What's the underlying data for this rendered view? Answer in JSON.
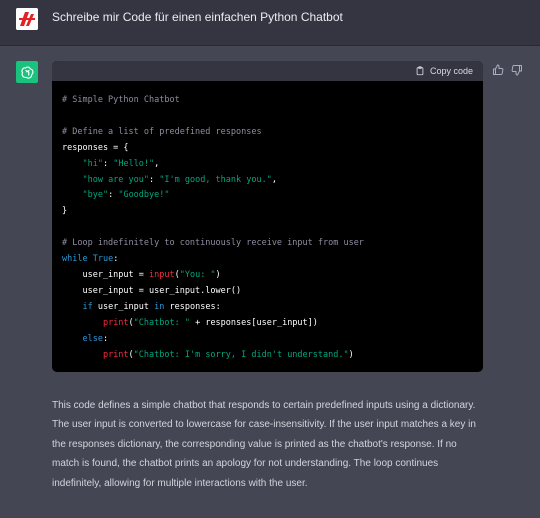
{
  "user_message": "Schreibe mir Code für einen einfachen Python Chatbot",
  "code_block": {
    "copy_label": "Copy code",
    "lines": [
      [
        {
          "t": "# Simple Python Chatbot",
          "c": "comment"
        }
      ],
      [],
      [
        {
          "t": "# Define a list of predefined responses",
          "c": "comment"
        }
      ],
      [
        {
          "t": "responses = {",
          "c": "default"
        }
      ],
      [
        {
          "t": "    ",
          "c": "default"
        },
        {
          "t": "\"hi\"",
          "c": "str"
        },
        {
          "t": ": ",
          "c": "default"
        },
        {
          "t": "\"Hello!\"",
          "c": "str"
        },
        {
          "t": ",",
          "c": "default"
        }
      ],
      [
        {
          "t": "    ",
          "c": "default"
        },
        {
          "t": "\"how are you\"",
          "c": "str"
        },
        {
          "t": ": ",
          "c": "default"
        },
        {
          "t": "\"I'm good, thank you.\"",
          "c": "str"
        },
        {
          "t": ",",
          "c": "default"
        }
      ],
      [
        {
          "t": "    ",
          "c": "default"
        },
        {
          "t": "\"bye\"",
          "c": "str"
        },
        {
          "t": ": ",
          "c": "default"
        },
        {
          "t": "\"Goodbye!\"",
          "c": "str"
        }
      ],
      [
        {
          "t": "}",
          "c": "default"
        }
      ],
      [],
      [
        {
          "t": "# Loop indefinitely to continuously receive input from user",
          "c": "comment"
        }
      ],
      [
        {
          "t": "while",
          "c": "kw"
        },
        {
          "t": " ",
          "c": "default"
        },
        {
          "t": "True",
          "c": "kw"
        },
        {
          "t": ":",
          "c": "default"
        }
      ],
      [
        {
          "t": "    user_input = ",
          "c": "default"
        },
        {
          "t": "input",
          "c": "fn"
        },
        {
          "t": "(",
          "c": "default"
        },
        {
          "t": "\"You: \"",
          "c": "str"
        },
        {
          "t": ")",
          "c": "default"
        }
      ],
      [
        {
          "t": "    user_input = user_input.lower()",
          "c": "default"
        }
      ],
      [
        {
          "t": "    ",
          "c": "default"
        },
        {
          "t": "if",
          "c": "kw"
        },
        {
          "t": " user_input ",
          "c": "default"
        },
        {
          "t": "in",
          "c": "kw"
        },
        {
          "t": " responses:",
          "c": "default"
        }
      ],
      [
        {
          "t": "        ",
          "c": "default"
        },
        {
          "t": "print",
          "c": "fn"
        },
        {
          "t": "(",
          "c": "default"
        },
        {
          "t": "\"Chatbot: \"",
          "c": "str"
        },
        {
          "t": " + responses[user_input])",
          "c": "default"
        }
      ],
      [
        {
          "t": "    ",
          "c": "default"
        },
        {
          "t": "else",
          "c": "kw"
        },
        {
          "t": ":",
          "c": "default"
        }
      ],
      [
        {
          "t": "        ",
          "c": "default"
        },
        {
          "t": "print",
          "c": "fn"
        },
        {
          "t": "(",
          "c": "default"
        },
        {
          "t": "\"Chatbot: I'm sorry, I didn't understand.\"",
          "c": "str"
        },
        {
          "t": ")",
          "c": "default"
        }
      ]
    ]
  },
  "explanation": "This code defines a simple chatbot that responds to certain predefined inputs using a dictionary. The user input is converted to lowercase for case-insensitivity. If the user input matches a key in the responses dictionary, the corresponding value is printed as the chatbot's response. If no match is found, the chatbot prints an apology for not understanding. The loop continues indefinitely, allowing for multiple interactions with the user.",
  "icons": {
    "user_avatar": "user-avatar-icon",
    "assistant_avatar": "openai-logo-icon",
    "copy": "clipboard-icon",
    "thumbs_up": "thumbs-up-icon",
    "thumbs_down": "thumbs-down-icon"
  },
  "colors": {
    "assistant_avatar_bg": "#19c37d",
    "code_string": "#00a67d",
    "code_keyword": "#2e95d3",
    "code_builtin": "#f22c3d",
    "code_comment": "#8e8ea0"
  }
}
